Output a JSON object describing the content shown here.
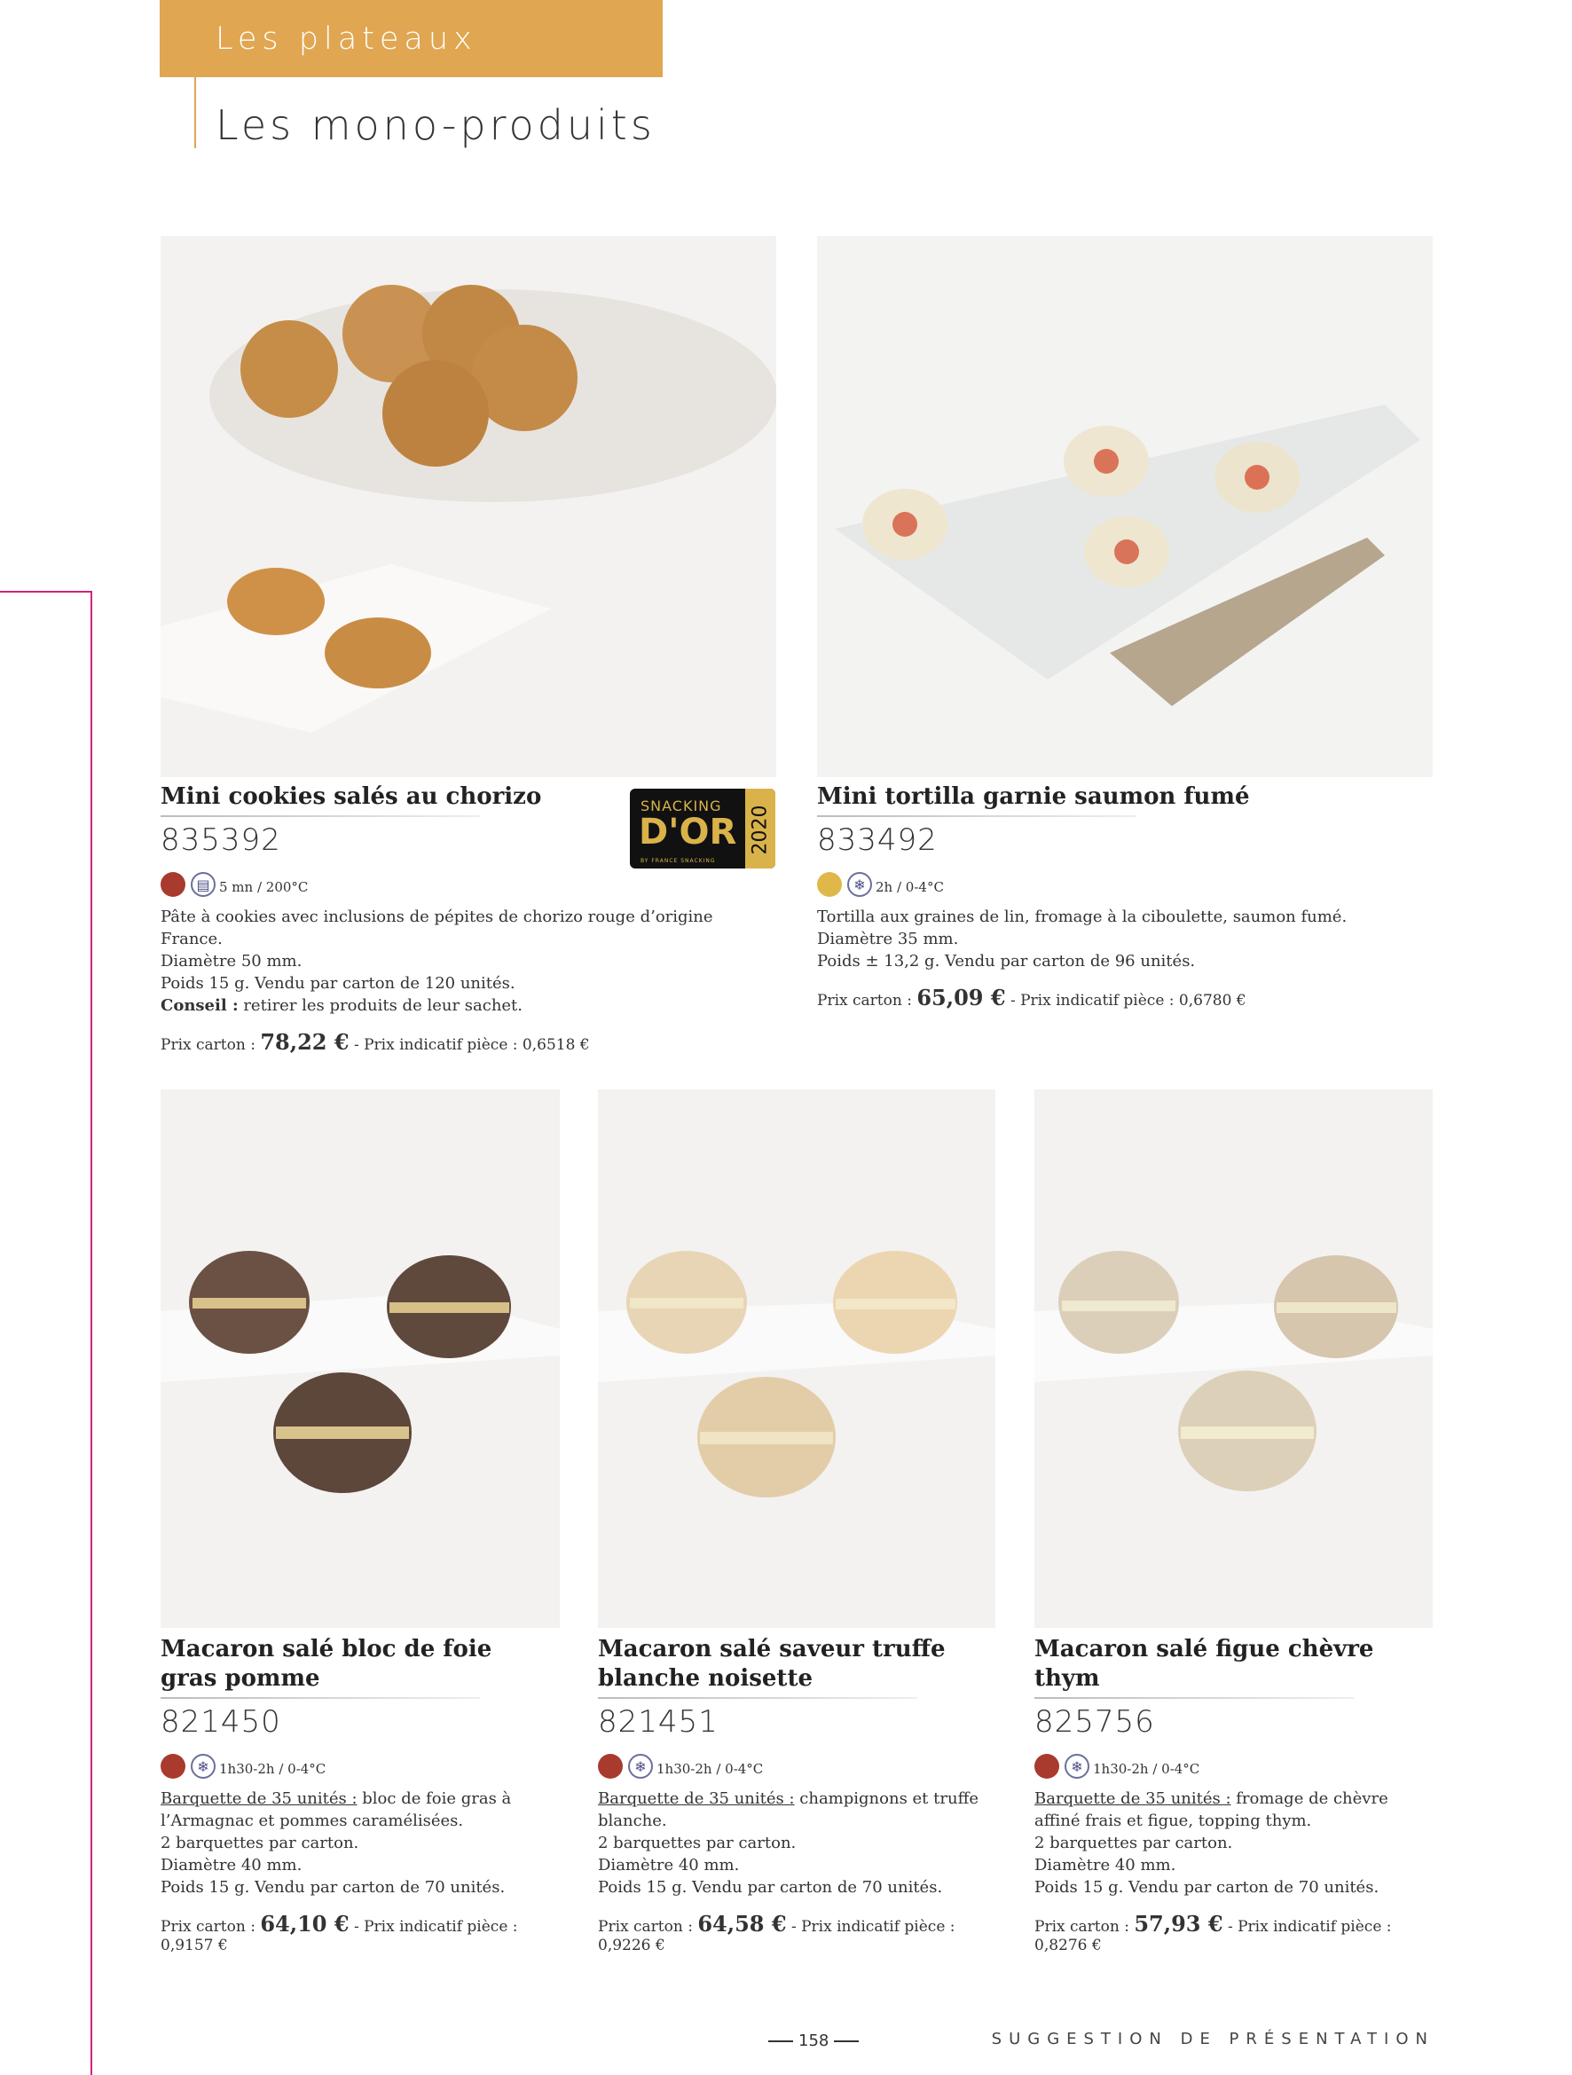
{
  "header": {
    "section": "Les plateaux",
    "subtitle": "Les mono-produits"
  },
  "badge": {
    "line1": "SNACKING",
    "line2": "D'OR",
    "year": "2020",
    "line3": "BY FRANCE SNACKING"
  },
  "products": [
    {
      "title": "Mini cookies salés au chorizo",
      "code": "835392",
      "dot_color": "#a83b2e",
      "icon": "oven-icon",
      "icon_glyph": "▤",
      "condition": "5 mn / 200°C",
      "desc": [
        "Pâte à cookies avec inclusions de pépites de chorizo rouge d’origine France.",
        "Diamètre 50 mm.",
        "Poids 15 g. Vendu par carton de 120 unités."
      ],
      "advice_label": "Conseil :",
      "advice": " retirer les produits de leur sachet.",
      "price_label": "Prix carton : ",
      "price": "78,22 €",
      "price_piece": " - Prix indicatif pièce : 0,6518 €"
    },
    {
      "title": "Mini tortilla garnie saumon fumé",
      "code": "833492",
      "dot_color": "#e0b84a",
      "icon": "thaw-icon",
      "icon_glyph": "❄",
      "condition": "2h / 0-4°C",
      "desc": [
        "Tortilla aux graines de lin, fromage à la ciboulette, saumon fumé.",
        "Diamètre 35 mm.",
        "Poids ± 13,2 g. Vendu par carton de 96 unités."
      ],
      "price_label": "Prix carton : ",
      "price": "65,09 €",
      "price_piece": " - Prix indicatif pièce : 0,6780 €"
    },
    {
      "title": "Macaron salé bloc de foie gras pomme",
      "code": "821450",
      "dot_color": "#a83b2e",
      "icon": "thaw-icon",
      "icon_glyph": "❄",
      "condition": "1h30-2h / 0-4°C",
      "lead": "Barquette de 35 unités :",
      "desc": [
        " bloc de foie gras à l’Armagnac et pommes caramélisées.",
        "2 barquettes par carton.",
        "Diamètre 40 mm.",
        "Poids 15 g. Vendu par carton de 70 unités."
      ],
      "price_label": "Prix carton : ",
      "price": "64,10 €",
      "price_piece": " - Prix indicatif pièce : 0,9157 €"
    },
    {
      "title": "Macaron salé saveur truffe blanche noisette",
      "code": "821451",
      "dot_color": "#a83b2e",
      "icon": "thaw-icon",
      "icon_glyph": "❄",
      "condition": "1h30-2h / 0-4°C",
      "lead": "Barquette de 35 unités :",
      "desc": [
        " champignons et truffe blanche.",
        "2 barquettes par carton.",
        "Diamètre 40 mm.",
        "Poids 15 g. Vendu par carton de 70 unités."
      ],
      "price_label": "Prix carton : ",
      "price": "64,58 €",
      "price_piece": " - Prix indicatif pièce : 0,9226 €"
    },
    {
      "title": "Macaron salé figue chèvre thym",
      "code": "825756",
      "dot_color": "#a83b2e",
      "icon": "thaw-icon",
      "icon_glyph": "❄",
      "condition": "1h30-2h / 0-4°C",
      "lead": "Barquette de 35 unités :",
      "desc": [
        " fromage de chèvre affiné frais et figue, topping thym.",
        "2 barquettes par carton.",
        "Diamètre 40 mm.",
        "Poids 15 g. Vendu par carton de 70 unités."
      ],
      "price_label": "Prix carton : ",
      "price": "57,93 €",
      "price_piece": " - Prix indicatif pièce : 0,8276 €"
    }
  ],
  "footer": {
    "page": "158",
    "note": "SUGGESTION DE PRÉSENTATION"
  }
}
